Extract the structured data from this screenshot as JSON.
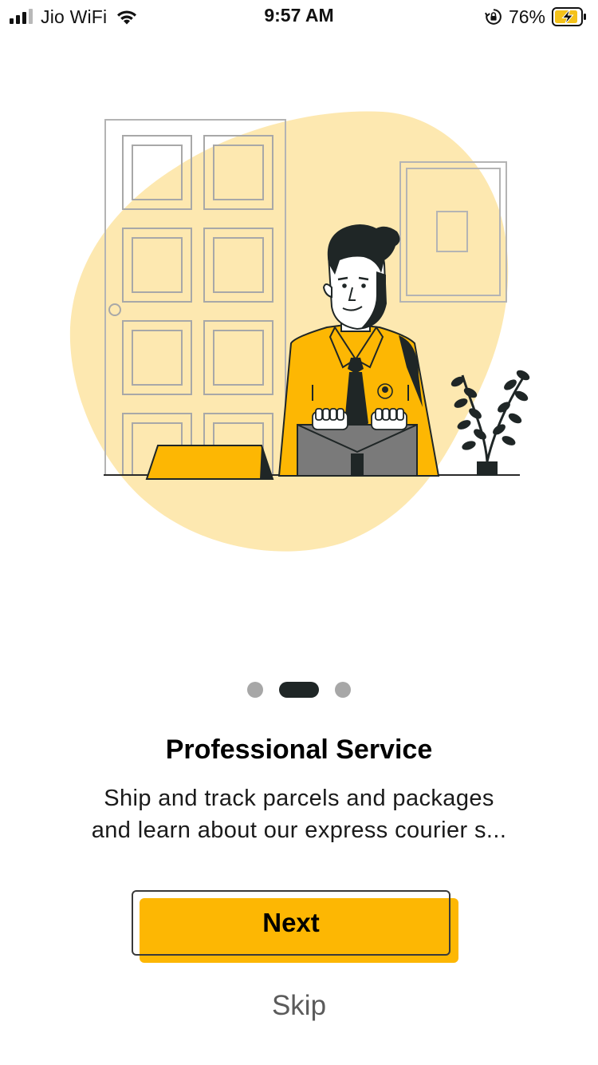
{
  "status_bar": {
    "carrier": "Jio WiFi",
    "time": "9:57 AM",
    "battery_percent": "76%",
    "signal_bars_active": 3,
    "icons": [
      "signal-icon",
      "wifi-icon",
      "orientation-lock-icon",
      "battery-charging-icon"
    ]
  },
  "onboarding": {
    "illustration": "courier-professional-illustration",
    "pager": {
      "total": 3,
      "active_index": 1
    },
    "title": "Professional Service",
    "description_line1": "Ship and track parcels and packages",
    "description_line2": "and learn about our express courier s...",
    "next_label": "Next",
    "skip_label": "Skip"
  },
  "colors": {
    "accent": "#fdb703",
    "blob": "#fde8b0",
    "dark": "#1f2626",
    "dot_inactive": "#a7a7a7"
  }
}
